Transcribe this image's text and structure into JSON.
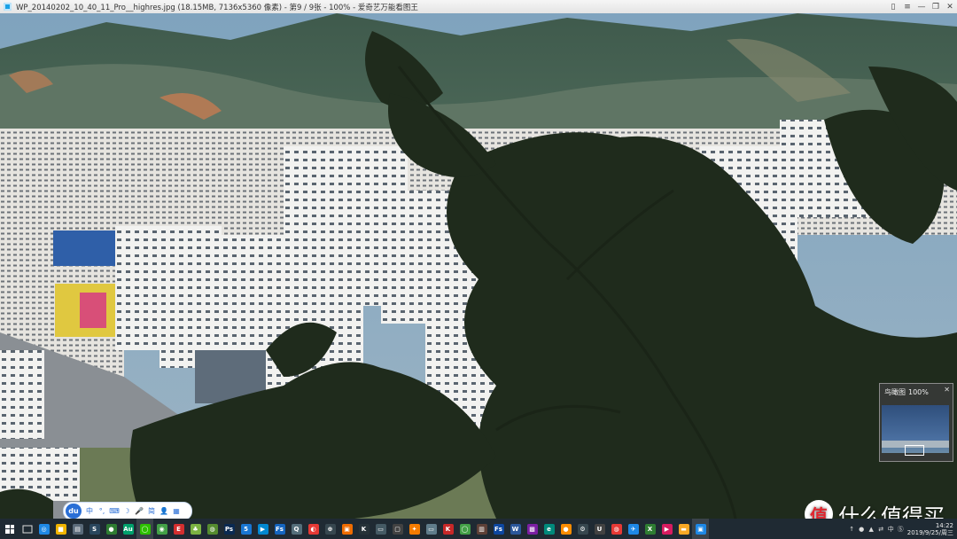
{
  "window": {
    "title": "WP_20140202_10_40_11_Pro__highres.jpg (18.15MB, 7136x5360 像素) - 第9 / 9张 - 100% - 爱奇艺万能看图王",
    "controls": {
      "pin": "▯",
      "menu": "≡",
      "minimize": "—",
      "restore": "❐",
      "close": "✕"
    }
  },
  "navigator": {
    "title": "鸟瞰图",
    "zoom": "100%",
    "close": "✕"
  },
  "ime": {
    "logo": "du",
    "items": [
      "中",
      "°,",
      "⌨",
      "☽",
      "🎤",
      "简",
      "👤",
      "▦"
    ]
  },
  "taskbar": {
    "apps": [
      {
        "name": "browser-blue",
        "color": "#1e88e5",
        "glyph": "◎"
      },
      {
        "name": "note-yellow",
        "color": "#f0b400",
        "glyph": "■"
      },
      {
        "name": "calendar",
        "color": "#5b6b7a",
        "glyph": "▤"
      },
      {
        "name": "steam",
        "color": "#2a475e",
        "glyph": "S"
      },
      {
        "name": "globe",
        "color": "#2e7d32",
        "glyph": "●"
      },
      {
        "name": "audition",
        "color": "#00a16c",
        "glyph": "Au"
      },
      {
        "name": "wechat",
        "color": "#2dc100",
        "glyph": "◯"
      },
      {
        "name": "green-dot",
        "color": "#43a047",
        "glyph": "◉"
      },
      {
        "name": "red-e",
        "color": "#d32f2f",
        "glyph": "E"
      },
      {
        "name": "leaf",
        "color": "#7cb342",
        "glyph": "♣"
      },
      {
        "name": "wifi",
        "color": "#558b2f",
        "glyph": "◍"
      },
      {
        "name": "photoshop",
        "color": "#0a2a52",
        "glyph": "Ps"
      },
      {
        "name": "speech",
        "color": "#1976d2",
        "glyph": "5"
      },
      {
        "name": "player",
        "color": "#0288d1",
        "glyph": "▶"
      },
      {
        "name": "fs-blue",
        "color": "#1565c0",
        "glyph": "Fs"
      },
      {
        "name": "qq",
        "color": "#546e7a",
        "glyph": "Q"
      },
      {
        "name": "weibo",
        "color": "#e53935",
        "glyph": "◐"
      },
      {
        "name": "network",
        "color": "#37474f",
        "glyph": "⊕"
      },
      {
        "name": "orange-box",
        "color": "#ef6c00",
        "glyph": "▣"
      },
      {
        "name": "k-app",
        "color": "#263238",
        "glyph": "K"
      },
      {
        "name": "folder",
        "color": "#455a64",
        "glyph": "▭"
      },
      {
        "name": "capture",
        "color": "#424242",
        "glyph": "▢"
      },
      {
        "name": "orange-star",
        "color": "#f57c00",
        "glyph": "✦"
      },
      {
        "name": "monitor",
        "color": "#607d8b",
        "glyph": "▭"
      },
      {
        "name": "red-k",
        "color": "#c62828",
        "glyph": "K"
      },
      {
        "name": "chat-green",
        "color": "#43a047",
        "glyph": "◯"
      },
      {
        "name": "books",
        "color": "#5d4037",
        "glyph": "▥"
      },
      {
        "name": "fs-dark",
        "color": "#0d47a1",
        "glyph": "Fs"
      },
      {
        "name": "word",
        "color": "#2b579a",
        "glyph": "W"
      },
      {
        "name": "picture",
        "color": "#7b1fa2",
        "glyph": "▩"
      },
      {
        "name": "edge",
        "color": "#00897b",
        "glyph": "e"
      },
      {
        "name": "orange-circle",
        "color": "#fb8c00",
        "glyph": "●"
      },
      {
        "name": "gear-dark",
        "color": "#37474f",
        "glyph": "⚙"
      },
      {
        "name": "uwp",
        "color": "#424242",
        "glyph": "U"
      },
      {
        "name": "chrome",
        "color": "#e53935",
        "glyph": "◍"
      },
      {
        "name": "share-blue",
        "color": "#1e88e5",
        "glyph": "✈"
      },
      {
        "name": "excel-green",
        "color": "#2e7d32",
        "glyph": "X"
      },
      {
        "name": "pink-flag",
        "color": "#d81b60",
        "glyph": "▶"
      },
      {
        "name": "explorer",
        "color": "#f9a825",
        "glyph": "▬"
      },
      {
        "name": "image-viewer",
        "color": "#1e88e5",
        "glyph": "▣"
      }
    ],
    "tray": [
      "↑",
      "●",
      "▲",
      "⇄",
      "中",
      "Ⓢ"
    ],
    "clock": {
      "time": "14:22",
      "date": "2019/9/25/周三"
    }
  },
  "watermark": {
    "logo": "值",
    "text": "什么值得买"
  }
}
